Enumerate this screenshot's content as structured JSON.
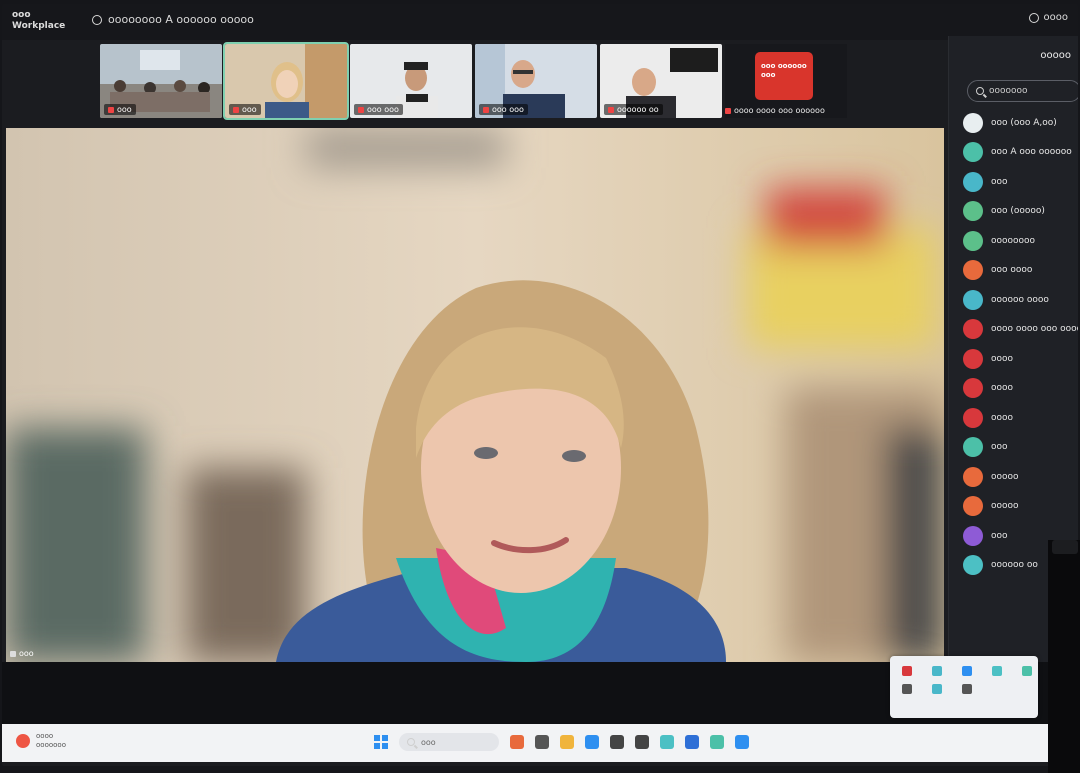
{
  "app": {
    "logo_text": "ooo Workplace"
  },
  "meeting": {
    "title": "oooooooo A oooooo ooooo"
  },
  "top_right": {
    "text": "oooo"
  },
  "participants_strip": [
    {
      "name": "ooo",
      "active": false
    },
    {
      "name": "ooo",
      "active": true
    },
    {
      "name": "ooo ooo",
      "active": false
    },
    {
      "name": "ooo ooo",
      "active": false
    },
    {
      "name": "oooooo oo",
      "active": false
    }
  ],
  "brand_tile": {
    "box_text": "ooo oooooo ooo",
    "name": "oooo oooo ooo oooooo"
  },
  "main_speaker": {
    "label": "ooo"
  },
  "sidebar": {
    "title": "ooooo",
    "search_placeholder": "ooooooo",
    "participants": [
      {
        "name": "ooo (ooo A,oo)",
        "color": "#e8eef0"
      },
      {
        "name": "ooo A ooo oooooo",
        "color": "#4cc0a8"
      },
      {
        "name": "ooo",
        "color": "#49b7c9"
      },
      {
        "name": "ooo (ooooo)",
        "color": "#5cc08a"
      },
      {
        "name": "oooooooo",
        "color": "#5cc08a"
      },
      {
        "name": "ooo oooo",
        "color": "#e86a3c"
      },
      {
        "name": "oooooo oooo",
        "color": "#49b7c9"
      },
      {
        "name": "oooo oooo ooo oooo",
        "color": "#d8383c"
      },
      {
        "name": "oooo",
        "color": "#d8383c"
      },
      {
        "name": "oooo",
        "color": "#d8383c"
      },
      {
        "name": "oooo",
        "color": "#d8383c"
      },
      {
        "name": "ooo",
        "color": "#4cc0a8"
      },
      {
        "name": "ooooo",
        "color": "#e86a3c"
      },
      {
        "name": "ooooo",
        "color": "#e86a3c"
      },
      {
        "name": "ooo",
        "color": "#8e5bd6"
      },
      {
        "name": "oooooo oo",
        "color": "#4cc0c4"
      }
    ]
  },
  "taskbar": {
    "weather_line1": "oooo",
    "weather_line2": "ooooooo",
    "search_placeholder": "ooo"
  },
  "tray_icon_colors": [
    "#d8383c",
    "#49b7c9",
    "#2e8ff0",
    "#4cc0c4",
    "#4cc0a8",
    "#555",
    "#49b7c9",
    "#555"
  ],
  "taskbar_icon_colors": [
    "#e86a3c",
    "#555",
    "#f0b43c",
    "#2e8ff0",
    "#444",
    "#444",
    "#4cc0c4",
    "#2e6fd6",
    "#4cc0a8",
    "#2e8ff0"
  ]
}
